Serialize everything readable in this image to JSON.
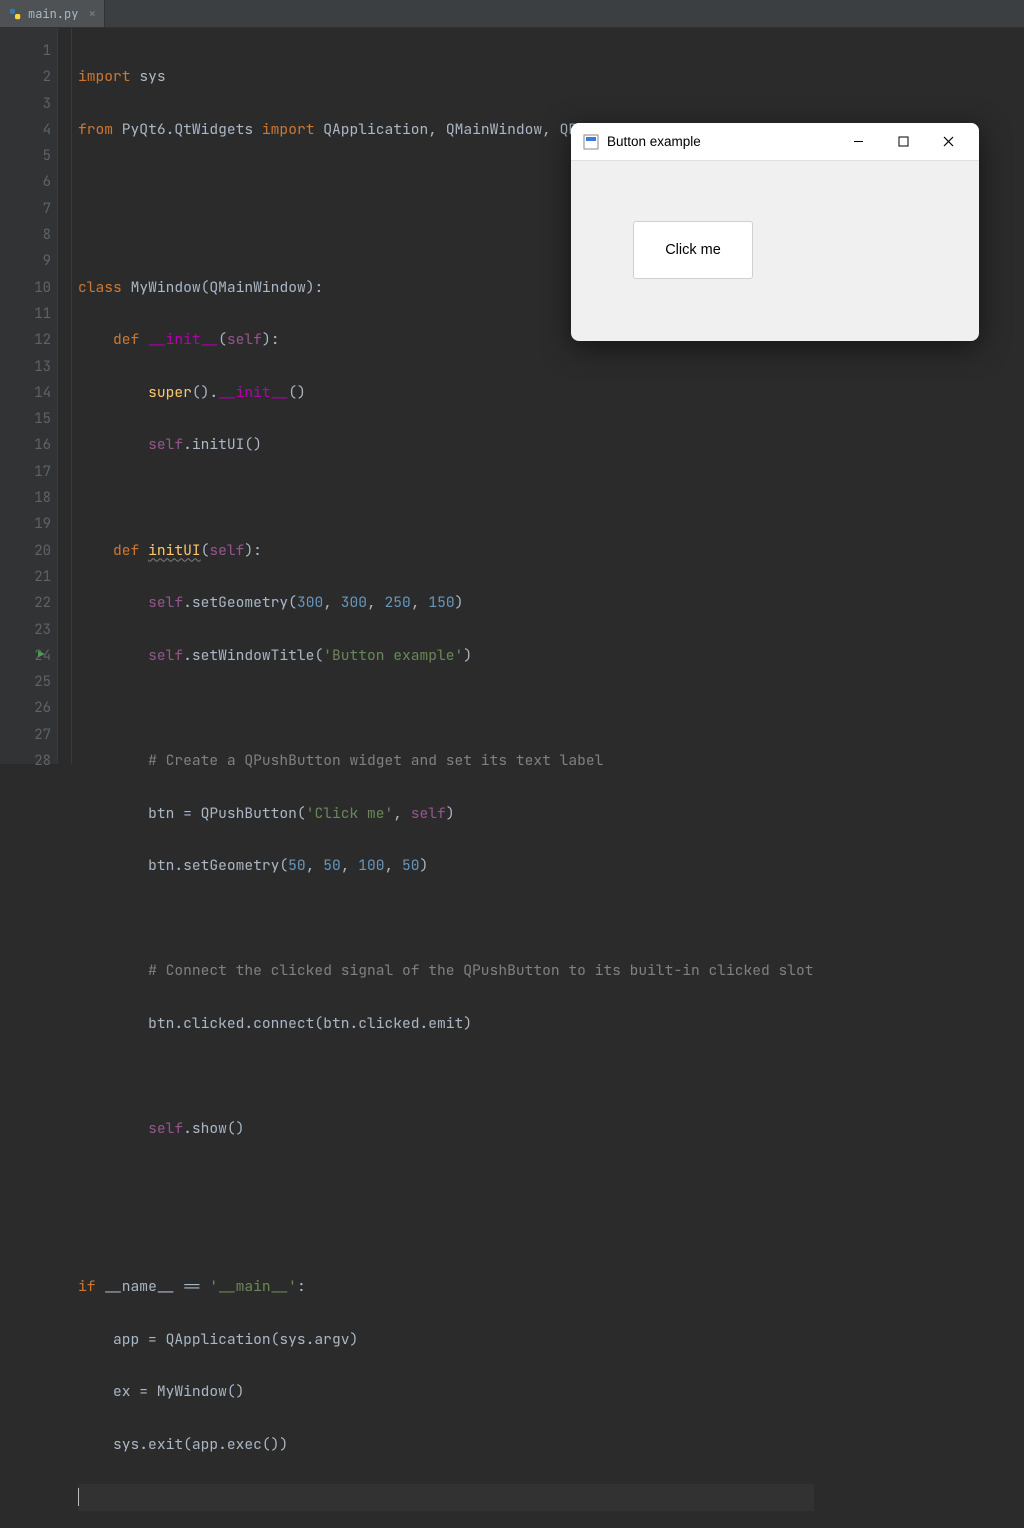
{
  "tab": {
    "filename": "main.py",
    "close": "×"
  },
  "popup": {
    "title": "Button example",
    "button_label": "Click me"
  },
  "gutter": {
    "lines": [
      "1",
      "2",
      "3",
      "4",
      "5",
      "6",
      "7",
      "8",
      "9",
      "10",
      "11",
      "12",
      "13",
      "14",
      "15",
      "16",
      "17",
      "18",
      "19",
      "20",
      "21",
      "22",
      "23",
      "24",
      "25",
      "26",
      "27",
      "28"
    ]
  },
  "code": {
    "l1_import": "import",
    "l1_sys": "sys",
    "l2_from": "from",
    "l2_mod": "PyQt6.QtWidgets",
    "l2_import": "import",
    "l2_names": "QApplication, QMainWindow, QPushButton",
    "l5_class": "class",
    "l5_name": "MyWindow",
    "l5_paren_open": "(",
    "l5_base": "QMainWindow",
    "l5_paren_close": "):",
    "l6_def": "def",
    "l6_name": "__init__",
    "l6_sig_open": "(",
    "l6_self": "self",
    "l6_sig_close": "):",
    "l7_super": "super",
    "l7_call": "().",
    "l7_init": "__init__",
    "l7_end": "()",
    "l8_self": "self",
    "l8_dot": ".",
    "l8_init": "initUI",
    "l8_end": "()",
    "l10_def": "def",
    "l10_name": "initUI",
    "l10_open": "(",
    "l10_self": "self",
    "l10_close": "):",
    "l11_self": "self",
    "l11_call": ".setGeometry(",
    "l11_a": "300",
    "l11_c1": ", ",
    "l11_b": "300",
    "l11_c2": ", ",
    "l11_c": "250",
    "l11_c3": ", ",
    "l11_d": "150",
    "l11_end": ")",
    "l12_self": "self",
    "l12_call": ".setWindowTitle(",
    "l12_str": "'Button example'",
    "l12_end": ")",
    "l14_cmt": "# Create a QPushButton widget and set its text label",
    "l15_btn": "btn = QPushButton(",
    "l15_str": "'Click me'",
    "l15_c": ", ",
    "l15_self": "self",
    "l15_end": ")",
    "l16_pre": "btn.setGeometry(",
    "l16_a": "50",
    "l16_c1": ", ",
    "l16_b": "50",
    "l16_c2": ", ",
    "l16_c": "100",
    "l16_c3": ", ",
    "l16_d": "50",
    "l16_end": ")",
    "l18_cmt": "# Connect the clicked signal of the QPushButton to its built-in clicked slot",
    "l19": "btn.clicked.connect(btn.clicked.emit)",
    "l21_self": "self",
    "l21_rest": ".show()",
    "l24_if": "if",
    "l24_name": "__name__",
    "l24_eq": " == ",
    "l24_str": "'__main__'",
    "l24_colon": ":",
    "l25": "app = QApplication(sys.argv)",
    "l26": "ex = MyWindow()",
    "l27": "sys.exit(app.exec())"
  }
}
